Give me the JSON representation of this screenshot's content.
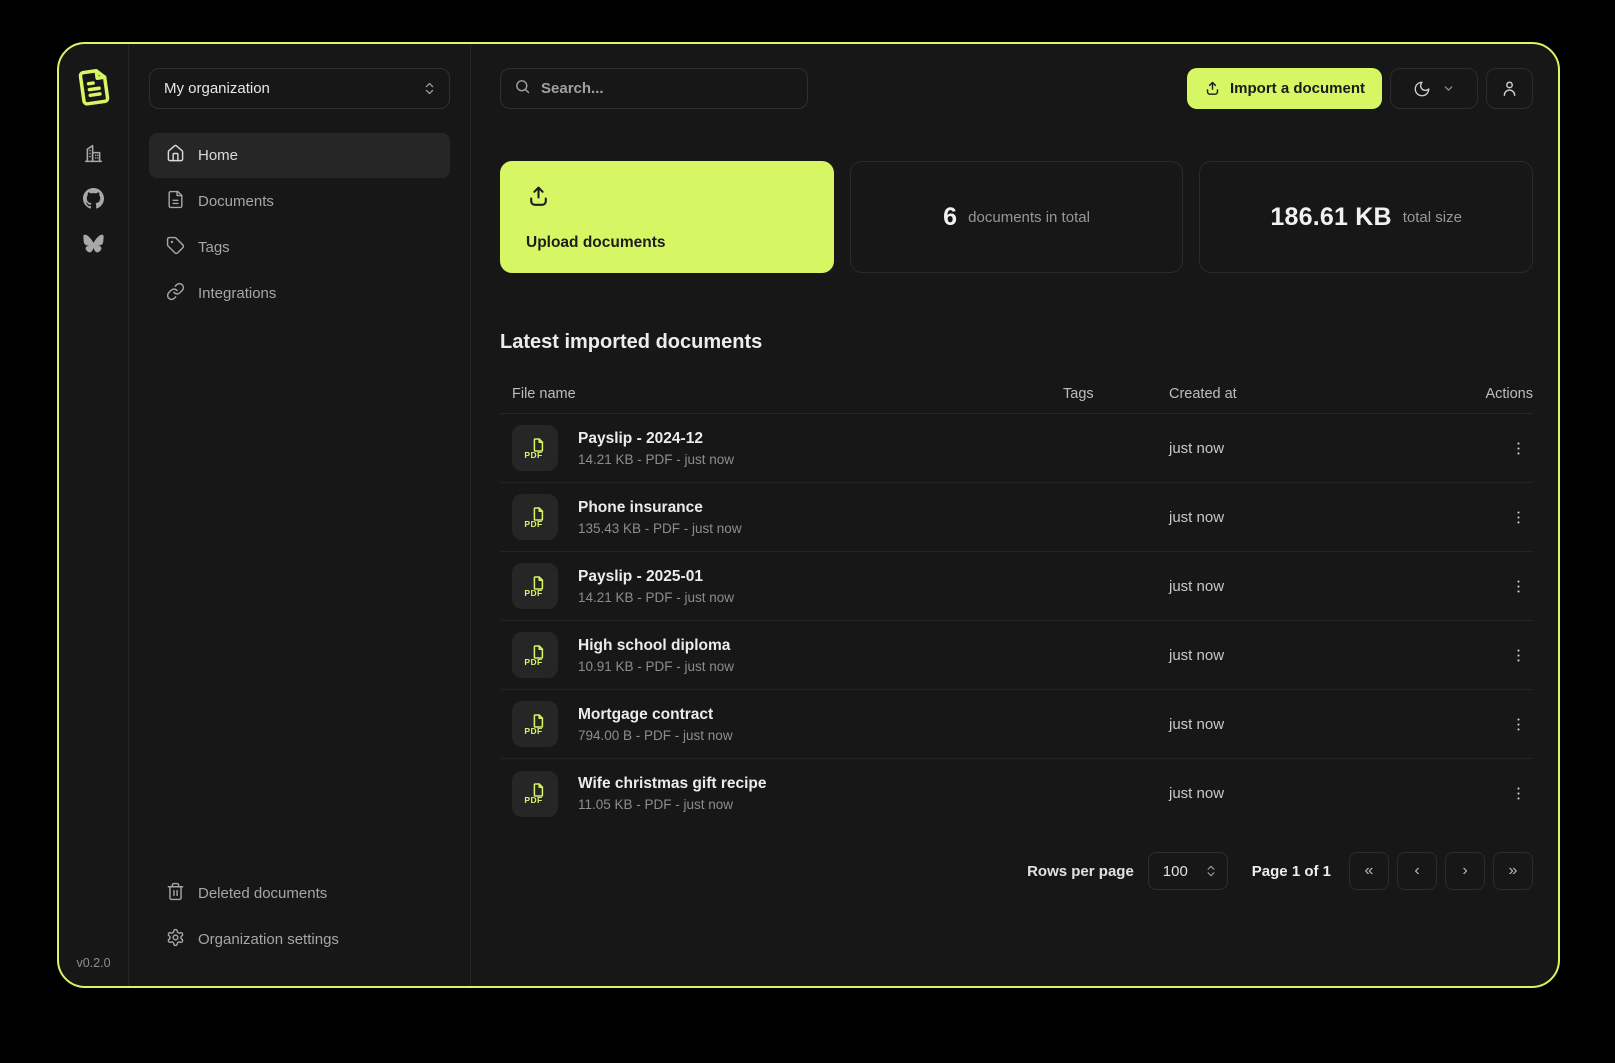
{
  "colors": {
    "accent": "#d6f664"
  },
  "version": "v0.2.0",
  "sidebar": {
    "org_select": {
      "value": "My organization"
    },
    "items": [
      {
        "label": "Home",
        "icon": "home",
        "name": "sidebar-item-home",
        "active": true
      },
      {
        "label": "Documents",
        "icon": "file-text",
        "name": "sidebar-item-documents",
        "active": false
      },
      {
        "label": "Tags",
        "icon": "tag",
        "name": "sidebar-item-tags",
        "active": false
      },
      {
        "label": "Integrations",
        "icon": "link",
        "name": "sidebar-item-integrations",
        "active": false
      }
    ],
    "footer_items": [
      {
        "label": "Deleted documents",
        "icon": "trash",
        "name": "sidebar-item-deleted-documents",
        "active": false
      },
      {
        "label": "Organization settings",
        "icon": "gear",
        "name": "sidebar-item-organization-settings",
        "active": false
      }
    ]
  },
  "topbar": {
    "search_placeholder": "Search...",
    "import_button": "Import a document"
  },
  "stats": {
    "upload_card_label": "Upload documents",
    "documents_total": {
      "value": "6",
      "label": "documents in total"
    },
    "total_size": {
      "value": "186.61 KB",
      "label": "total size"
    }
  },
  "documents_section": {
    "title": "Latest imported documents",
    "headers": {
      "file": "File name",
      "tags": "Tags",
      "created": "Created at",
      "actions": "Actions"
    },
    "file_type_badge": "PDF",
    "rows": [
      {
        "name": "Payslip - 2024-12",
        "meta": "14.21 KB - PDF - just now",
        "created": "just now"
      },
      {
        "name": "Phone insurance",
        "meta": "135.43 KB - PDF - just now",
        "created": "just now"
      },
      {
        "name": "Payslip - 2025-01",
        "meta": "14.21 KB - PDF - just now",
        "created": "just now"
      },
      {
        "name": "High school diploma",
        "meta": "10.91 KB - PDF - just now",
        "created": "just now"
      },
      {
        "name": "Mortgage contract",
        "meta": "794.00 B - PDF - just now",
        "created": "just now"
      },
      {
        "name": "Wife christmas gift recipe",
        "meta": "11.05 KB - PDF - just now",
        "created": "just now"
      }
    ]
  },
  "pagination": {
    "rows_per_page_label": "Rows per page",
    "page_size": "100",
    "page_info": "Page 1 of 1",
    "buttons": [
      {
        "glyph": "«",
        "name": "pagination-first-page-button"
      },
      {
        "glyph": "‹",
        "name": "pagination-previous-page-button"
      },
      {
        "glyph": "›",
        "name": "pagination-next-page-button"
      },
      {
        "glyph": "»",
        "name": "pagination-last-page-button"
      }
    ]
  }
}
